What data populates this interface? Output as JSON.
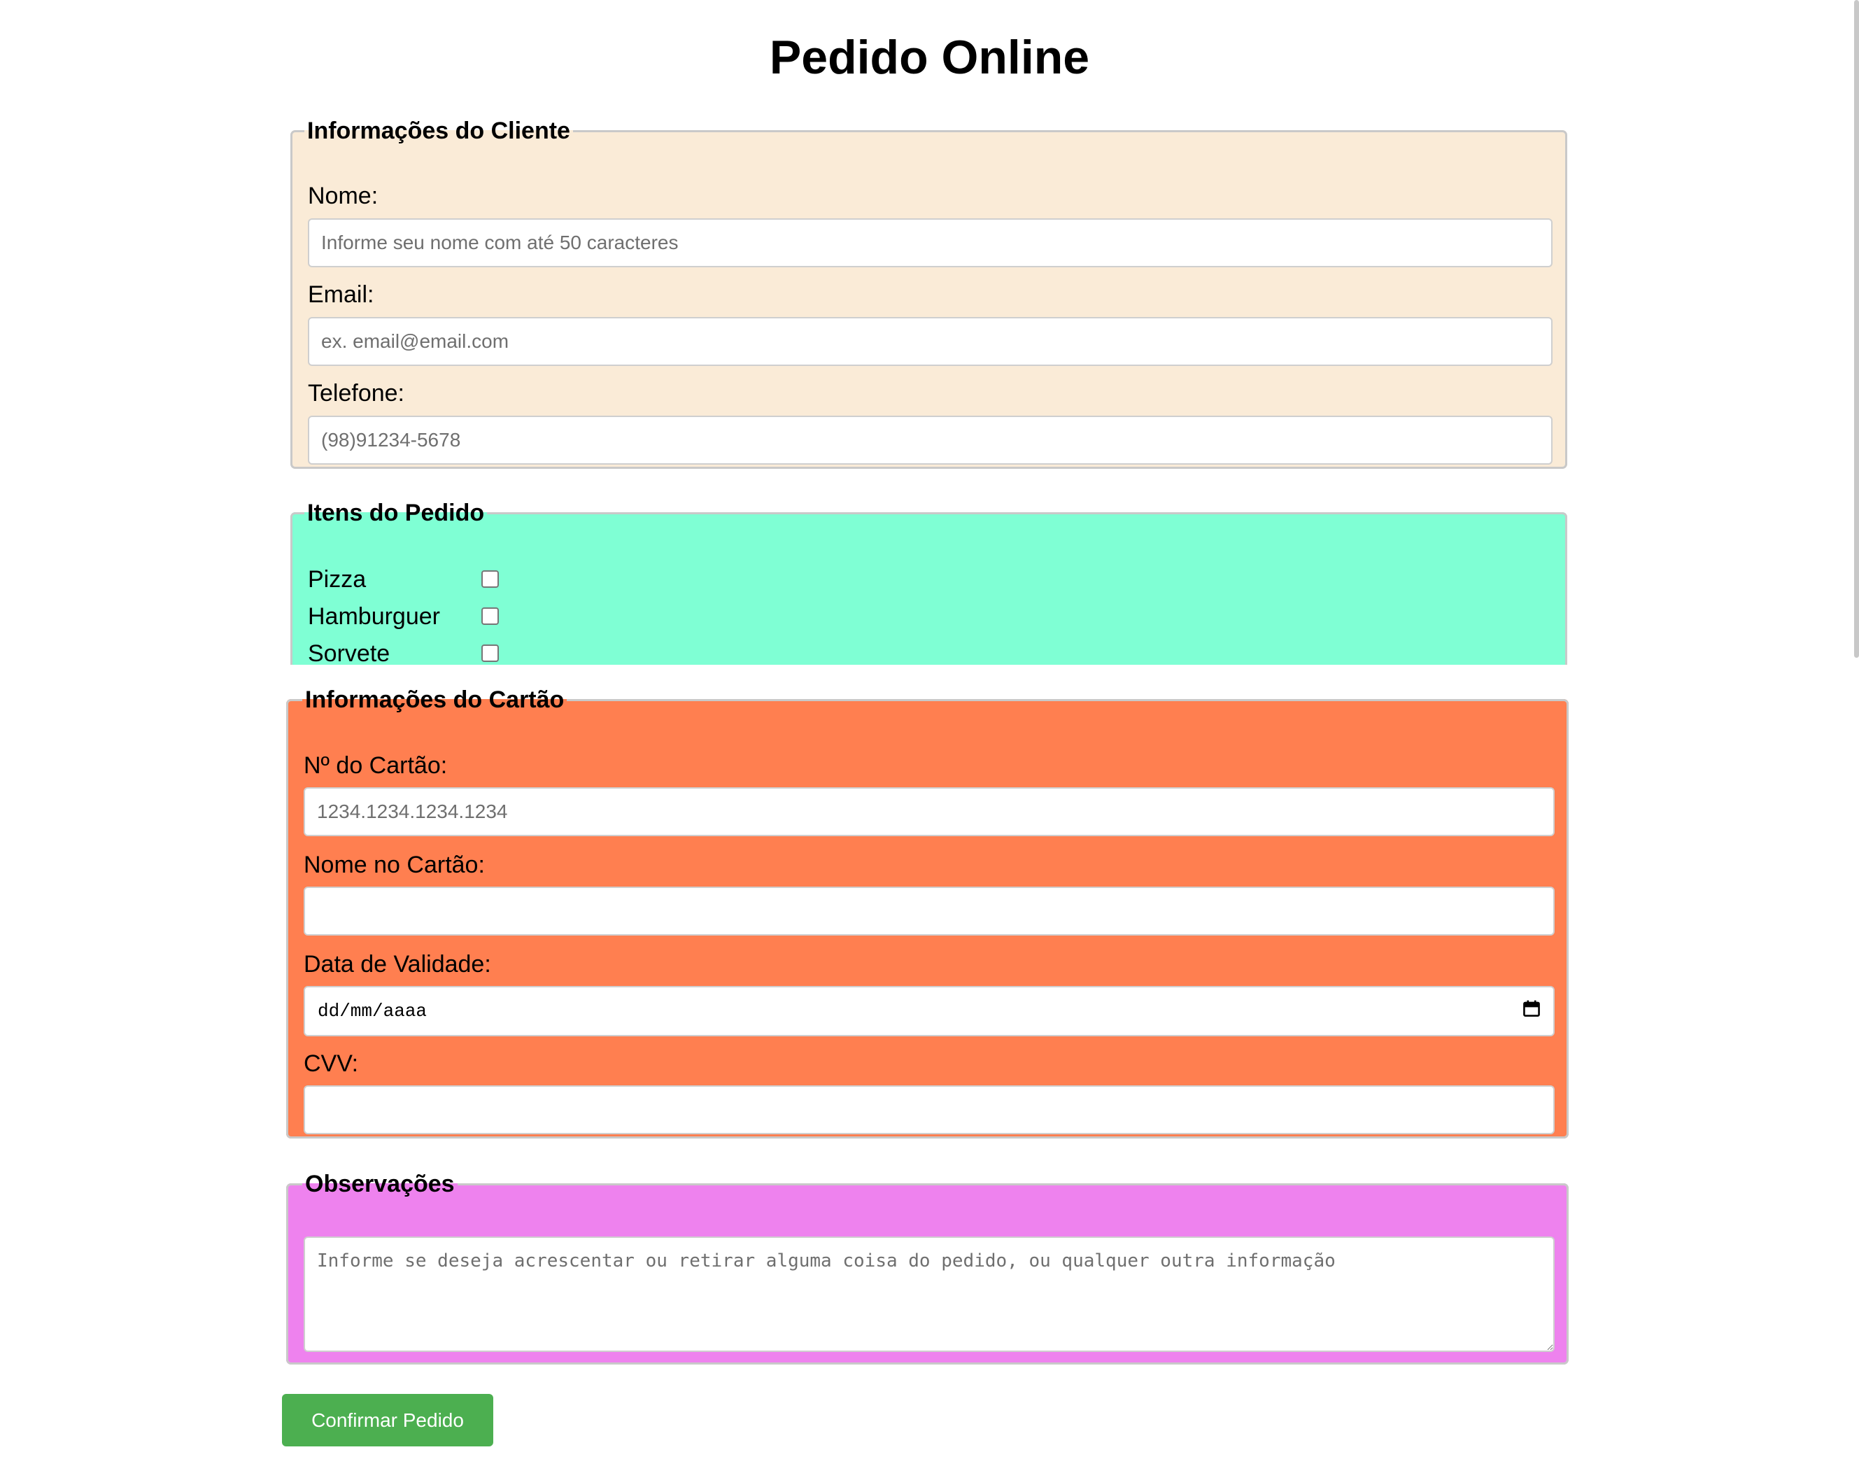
{
  "title": "Pedido Online",
  "cliente": {
    "legend": "Informações do Cliente",
    "nome_label": "Nome:",
    "nome_placeholder": "Informe seu nome com até 50 caracteres",
    "email_label": "Email:",
    "email_placeholder": "ex. email@email.com",
    "telefone_label": "Telefone:",
    "telefone_placeholder": "(98)91234-5678"
  },
  "itens": {
    "legend": "Itens do Pedido",
    "items": [
      {
        "label": "Pizza",
        "checked": false
      },
      {
        "label": "Hamburguer",
        "checked": false
      },
      {
        "label": "Sorvete",
        "checked": false
      }
    ]
  },
  "cartao": {
    "legend": "Informações do Cartão",
    "numero_label": "Nº do Cartão:",
    "numero_placeholder": "1234.1234.1234.1234",
    "nome_label": "Nome no Cartão:",
    "validade_label": "Data de Validade:",
    "validade_placeholder": "dd/mm/aaaa",
    "cvv_label": "CVV:"
  },
  "observacoes": {
    "legend": "Observações",
    "placeholder": "Informe se deseja acrescentar ou retirar alguma coisa do pedido, ou qualquer outra informação"
  },
  "submit_label": "Confirmar Pedido",
  "colors": {
    "cliente_bg": "#faebd7",
    "itens_bg": "#7fffd4",
    "cartao_bg": "#ff7f50",
    "observacoes_bg": "#ee82ee",
    "submit_bg": "#4caf50"
  },
  "icons": {
    "validade": "calendar-icon"
  }
}
